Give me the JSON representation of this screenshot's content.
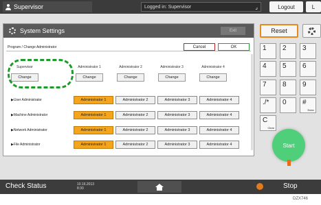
{
  "topbar": {
    "user": "Supervisor",
    "login_status": "Logged in: Supervisor",
    "logout": "Logout",
    "lang": "L"
  },
  "window": {
    "title": "System Settings",
    "exit": "Exit",
    "page_title": "Program / Change Administrator",
    "cancel": "Cancel",
    "ok": "OK",
    "columns": [
      {
        "header": "Supervisor",
        "button": "Change"
      },
      {
        "header": "Administrator 1",
        "button": "Change"
      },
      {
        "header": "Administrator 2",
        "button": "Change"
      },
      {
        "header": "Administrator 3",
        "button": "Change"
      },
      {
        "header": "Administrator 4",
        "button": "Change"
      }
    ],
    "rows": [
      {
        "label": "User Administrator",
        "selected": 0,
        "options": [
          "Administrator 1",
          "Administrator 2",
          "Administrator 3",
          "Administrator 4"
        ]
      },
      {
        "label": "Machine Administrator",
        "selected": 0,
        "options": [
          "Administrator 1",
          "Administrator 2",
          "Administrator 3",
          "Administrator 4"
        ]
      },
      {
        "label": "Network Administrator",
        "selected": 0,
        "options": [
          "Administrator 1",
          "Administrator 2",
          "Administrator 3",
          "Administrator 4"
        ]
      },
      {
        "label": "File Administrator",
        "selected": 0,
        "options": [
          "Administrator 1",
          "Administrator 2",
          "Administrator 3",
          "Administrator 4"
        ]
      }
    ]
  },
  "right_panel": {
    "reset": "Reset",
    "keys": [
      {
        "label": "1",
        "sub": ""
      },
      {
        "label": "2",
        "sub": ""
      },
      {
        "label": "3",
        "sub": ""
      },
      {
        "label": "4",
        "sub": ""
      },
      {
        "label": "5",
        "sub": ""
      },
      {
        "label": "6",
        "sub": ""
      },
      {
        "label": "7",
        "sub": ""
      },
      {
        "label": "8",
        "sub": ""
      },
      {
        "label": "9",
        "sub": ""
      },
      {
        "label": "./*",
        "sub": ""
      },
      {
        "label": "0",
        "sub": ""
      },
      {
        "label": "#",
        "sub": "Enter"
      },
      {
        "label": "C",
        "sub": "Clear"
      }
    ],
    "start": "Start"
  },
  "bottombar": {
    "check_status": "Check Status",
    "date": "10.16.2013",
    "time": "8:30",
    "stop": "Stop"
  },
  "figure_code": "DZX746",
  "colors": {
    "selected": "#f5a51b",
    "reset_border": "#e58a1c",
    "start": "#4fcf7a",
    "highlight_ring": "#1d9a2a"
  },
  "icons": [
    "user-icon",
    "gear-icon",
    "home-icon",
    "stop-icon"
  ]
}
